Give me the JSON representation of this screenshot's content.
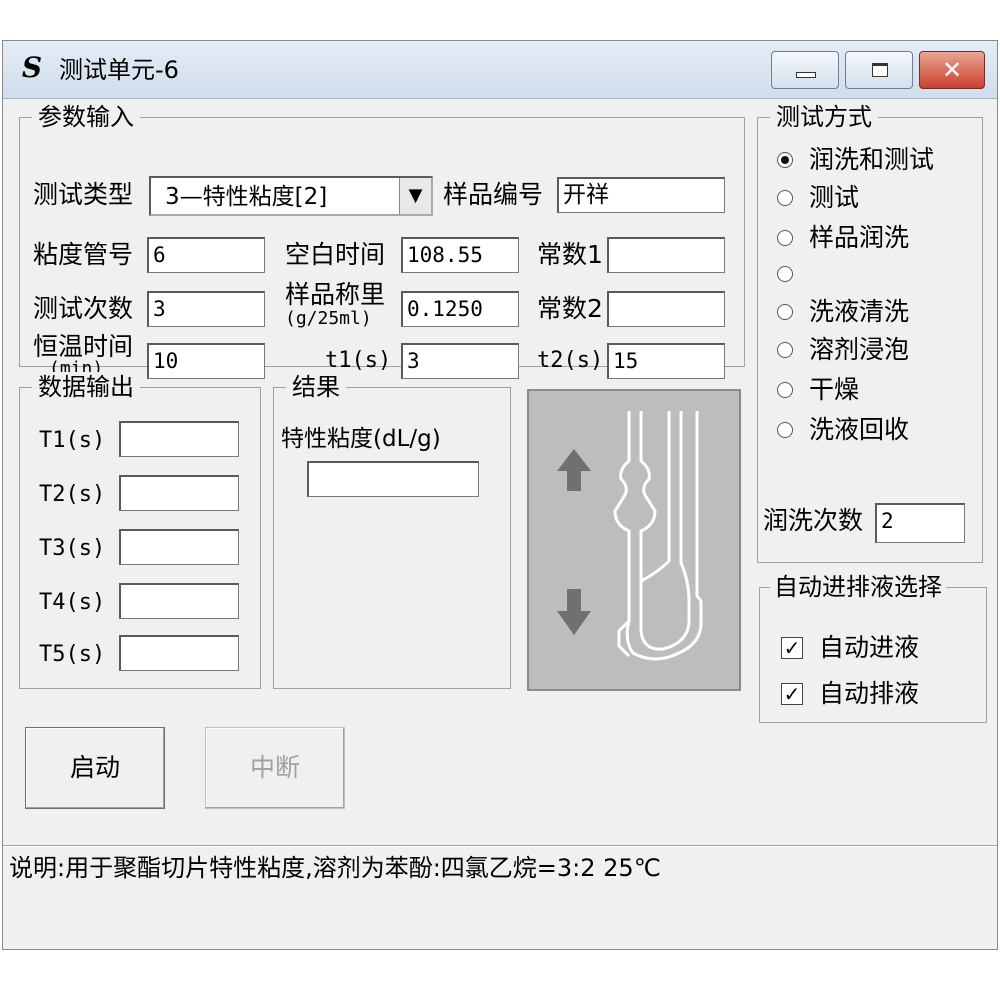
{
  "window": {
    "app_icon_glyph": "S",
    "title": "测试单元-6",
    "min_glyph": "",
    "max_glyph": "",
    "close_glyph": "✕"
  },
  "params": {
    "group_title": "参数输入",
    "test_type_label": "测试类型",
    "test_type_value": "3—特性粘度[2]",
    "dropdown_glyph": "▼",
    "sample_no_label": "样品编号",
    "sample_no_value": "开祥",
    "tube_no_label": "粘度管号",
    "tube_no_value": "6",
    "blank_time_label": "空白时间",
    "blank_time_value": "108.55",
    "const1_label": "常数1",
    "const1_value": "",
    "test_count_label": "测试次数",
    "test_count_value": "3",
    "sample_weight_label": "样品称里",
    "sample_weight_unit": "(g/25ml)",
    "sample_weight_value": "0.1250",
    "const2_label": "常数2",
    "const2_value": "",
    "temp_time_label": "恒温时间",
    "temp_time_unit": "(min)",
    "temp_time_value": "10",
    "t1_label": "t1(s)",
    "t1_value": "3",
    "t2_label": "t2(s)",
    "t2_value": "15"
  },
  "output": {
    "group_title": "数据输出",
    "rows": [
      {
        "label": "T1(s)",
        "value": ""
      },
      {
        "label": "T2(s)",
        "value": ""
      },
      {
        "label": "T3(s)",
        "value": ""
      },
      {
        "label": "T4(s)",
        "value": ""
      },
      {
        "label": "T5(s)",
        "value": ""
      }
    ]
  },
  "result": {
    "group_title": "结果",
    "viscosity_label": "特性粘度(dL/g)",
    "viscosity_value": ""
  },
  "mode": {
    "group_title": "测试方式",
    "options": [
      {
        "label": "润洗和测试",
        "selected": true
      },
      {
        "label": "测试",
        "selected": false
      },
      {
        "label": "样品润洗",
        "selected": false
      },
      {
        "label": "",
        "selected": false
      },
      {
        "label": "洗液清洗",
        "selected": false
      },
      {
        "label": "溶剂浸泡",
        "selected": false
      },
      {
        "label": "干燥",
        "selected": false
      },
      {
        "label": "洗液回收",
        "selected": false
      }
    ],
    "rinse_count_label": "润洗次数",
    "rinse_count_value": "2"
  },
  "auto": {
    "group_title": "自动进排液选择",
    "check_glyph": "✓",
    "auto_in_label": "自动进液",
    "auto_in_checked": true,
    "auto_out_label": "自动排液",
    "auto_out_checked": true
  },
  "buttons": {
    "start_label": "启动",
    "abort_label": "中断"
  },
  "status": {
    "text": "说明:用于聚酯切片特性粘度,溶剂为苯酚:四氯乙烷=3:2 25℃"
  },
  "colors": {
    "window_bg": "#f0f0f0",
    "panel_bg": "#bdbdbd",
    "tube_stroke": "#ffffff",
    "arrow_fill": "#707070",
    "close_btn": "#c8412c"
  }
}
